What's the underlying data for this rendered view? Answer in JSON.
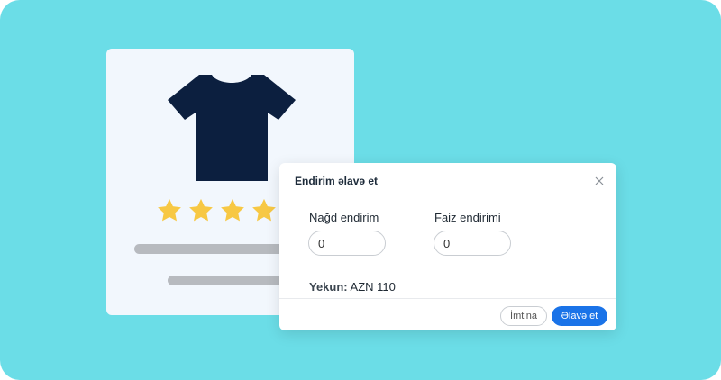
{
  "product": {
    "icon": "tshirt-icon",
    "rating_stars": 4,
    "colors": {
      "tshirt": "#0c1f3f",
      "star": "#f7c844",
      "card": "#f2f7fd",
      "bars": "#b7babf"
    }
  },
  "dialog": {
    "title": "Endirim əlavə et",
    "close_icon": "close-icon",
    "cash_discount": {
      "label": "Nağd endirim",
      "value": "0"
    },
    "percent_discount": {
      "label": "Faiz endirimi",
      "value": "0"
    },
    "total": {
      "label": "Yekun:",
      "value": "AZN 110"
    },
    "cancel_label": "İmtina",
    "add_label": "Əlavə et"
  },
  "colors": {
    "background": "#6bdde7",
    "primary": "#1a73e8"
  }
}
